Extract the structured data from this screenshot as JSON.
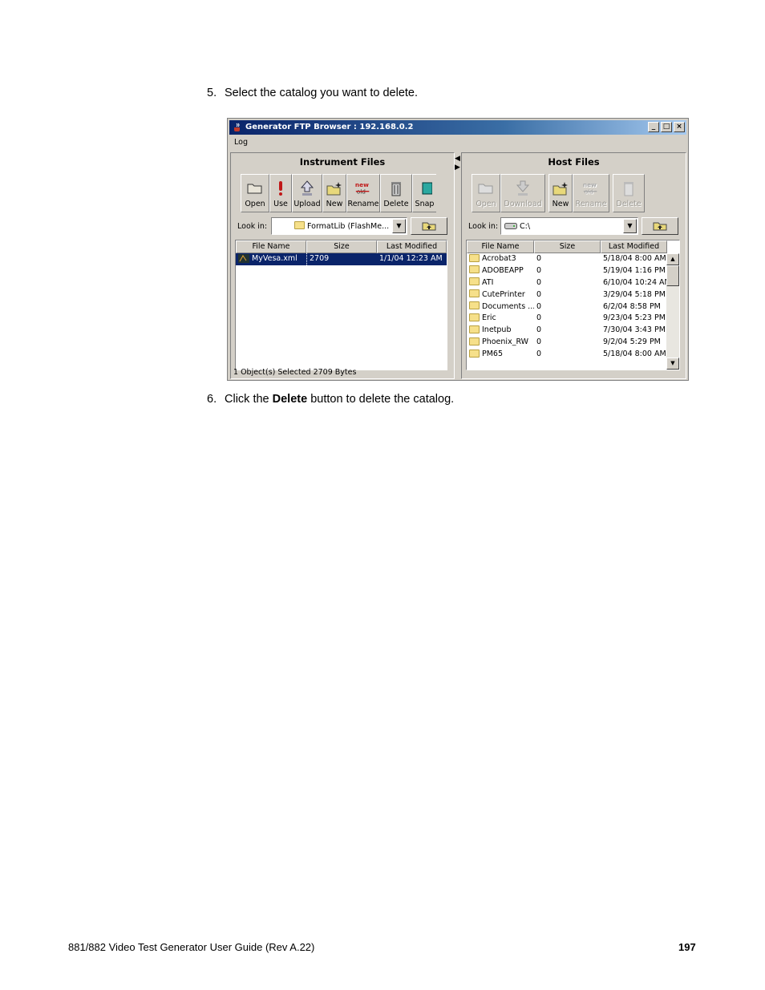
{
  "steps": [
    {
      "number": "5.",
      "text": "Select the catalog you want to delete."
    },
    {
      "number": "6.",
      "text_before": "Click the ",
      "bold": "Delete",
      "text_after": " button to delete the catalog."
    }
  ],
  "window": {
    "title": "Generator FTP Browser : 192.168.0.2",
    "controls": {
      "minimize": "_",
      "maximize": "□",
      "close": "×"
    },
    "menu": [
      "Log"
    ]
  },
  "instrument": {
    "title": "Instrument Files",
    "toolbar": [
      "Open",
      "Use",
      "Upload",
      "New",
      "Rename",
      "Delete",
      "Snap"
    ],
    "look_in_label": "Look in:",
    "look_in_value": "FormatLib   (FlashMe...",
    "columns": [
      "File Name",
      "Size",
      "Last Modified"
    ],
    "rows": [
      {
        "name": "MyVesa.xml",
        "size": "2709",
        "modified": "1/1/04 12:23 AM"
      }
    ],
    "status": "1 Object(s) Selected   2709 Bytes"
  },
  "host": {
    "title": "Host Files",
    "toolbar": [
      "Open",
      "Download",
      "New",
      "Rename",
      "Delete"
    ],
    "look_in_label": "Look in:",
    "look_in_value": "C:\\",
    "columns": [
      "File Name",
      "Size",
      "Last Modified"
    ],
    "rows": [
      {
        "name": "Acrobat3",
        "size": "0",
        "modified": "5/18/04 8:00 AM"
      },
      {
        "name": "ADOBEAPP",
        "size": "0",
        "modified": "5/19/04 1:16 PM"
      },
      {
        "name": "ATI",
        "size": "0",
        "modified": "6/10/04 10:24 AM"
      },
      {
        "name": "CutePrinter",
        "size": "0",
        "modified": "3/29/04 5:18 PM"
      },
      {
        "name": "Documents ...",
        "size": "0",
        "modified": "6/2/04 8:58 PM"
      },
      {
        "name": "Eric",
        "size": "0",
        "modified": "9/23/04 5:23 PM"
      },
      {
        "name": "Inetpub",
        "size": "0",
        "modified": "7/30/04 3:43 PM"
      },
      {
        "name": "Phoenix_RW",
        "size": "0",
        "modified": "9/2/04 5:29 PM"
      },
      {
        "name": "PM65",
        "size": "0",
        "modified": "5/18/04 8:00 AM"
      }
    ]
  },
  "footer": {
    "left": "881/882 Video Test Generator User Guide (Rev A.22)",
    "page": "197"
  }
}
